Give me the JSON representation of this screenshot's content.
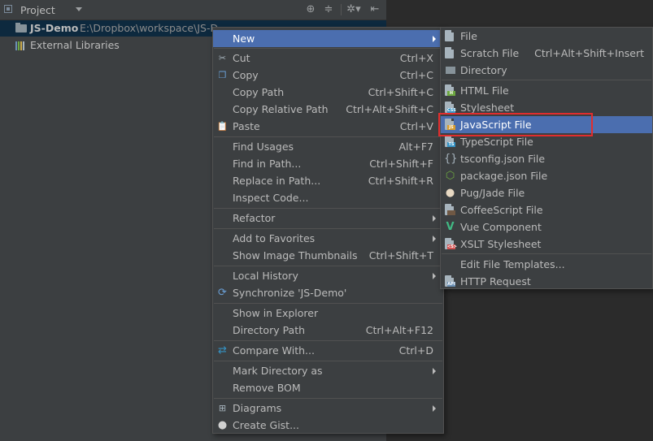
{
  "project_panel": {
    "title": "Project",
    "tree": {
      "project_name": "JS-Demo",
      "project_path": "E:\\Dropbox\\workspace\\JS-D",
      "external_libraries": "External Libraries"
    }
  },
  "context_menu": {
    "items": [
      {
        "label": "New",
        "submenu": true
      },
      {
        "label": "Cut",
        "shortcut": "Ctrl+X",
        "icon": "scissors-icon"
      },
      {
        "label": "Copy",
        "shortcut": "Ctrl+C",
        "icon": "copy-icon"
      },
      {
        "label": "Copy Path",
        "shortcut": "Ctrl+Shift+C"
      },
      {
        "label": "Copy Relative Path",
        "shortcut": "Ctrl+Alt+Shift+C"
      },
      {
        "label": "Paste",
        "shortcut": "Ctrl+V",
        "icon": "paste-icon"
      },
      {
        "label": "Find Usages",
        "shortcut": "Alt+F7"
      },
      {
        "label": "Find in Path...",
        "shortcut": "Ctrl+Shift+F"
      },
      {
        "label": "Replace in Path...",
        "shortcut": "Ctrl+Shift+R"
      },
      {
        "label": "Inspect Code..."
      },
      {
        "label": "Refactor",
        "submenu": true
      },
      {
        "label": "Add to Favorites",
        "submenu": true
      },
      {
        "label": "Show Image Thumbnails",
        "shortcut": "Ctrl+Shift+T"
      },
      {
        "label": "Local History",
        "submenu": true
      },
      {
        "label": "Synchronize 'JS-Demo'",
        "icon": "sync-icon"
      },
      {
        "label": "Show in Explorer"
      },
      {
        "label": "Directory Path",
        "shortcut": "Ctrl+Alt+F12"
      },
      {
        "label": "Compare With...",
        "shortcut": "Ctrl+D",
        "icon": "compare-icon"
      },
      {
        "label": "Mark Directory as",
        "submenu": true
      },
      {
        "label": "Remove BOM"
      },
      {
        "label": "Diagrams",
        "submenu": true,
        "icon": "diagram-icon"
      },
      {
        "label": "Create Gist...",
        "icon": "github-icon"
      }
    ]
  },
  "new_submenu": {
    "items": [
      {
        "label": "File",
        "icon": "file-icon"
      },
      {
        "label": "Scratch File",
        "shortcut": "Ctrl+Alt+Shift+Insert",
        "icon": "scratch-file-icon"
      },
      {
        "label": "Directory",
        "icon": "folder-icon"
      },
      {
        "label": "HTML File",
        "icon": "html-file-icon",
        "tag": "H"
      },
      {
        "label": "Stylesheet",
        "icon": "css-file-icon",
        "tag": "CSS"
      },
      {
        "label": "JavaScript File",
        "icon": "js-file-icon",
        "tag": "JS"
      },
      {
        "label": "TypeScript File",
        "icon": "ts-file-icon",
        "tag": "TS"
      },
      {
        "label": "tsconfig.json File",
        "icon": "tsconfig-icon"
      },
      {
        "label": "package.json File",
        "icon": "nodejs-icon"
      },
      {
        "label": "Pug/Jade File",
        "icon": "pug-icon"
      },
      {
        "label": "CoffeeScript File",
        "icon": "coffeescript-icon"
      },
      {
        "label": "Vue Component",
        "icon": "vue-icon"
      },
      {
        "label": "XSLT Stylesheet",
        "icon": "xslt-icon",
        "tag": "<S>"
      },
      {
        "label": "Edit File Templates..."
      },
      {
        "label": "HTTP Request",
        "icon": "http-request-icon",
        "tag": "API"
      }
    ]
  },
  "colors": {
    "highlight": "#4b6eaf",
    "menu_bg": "#3c3f41",
    "annotation_box": "#e12d2d"
  }
}
